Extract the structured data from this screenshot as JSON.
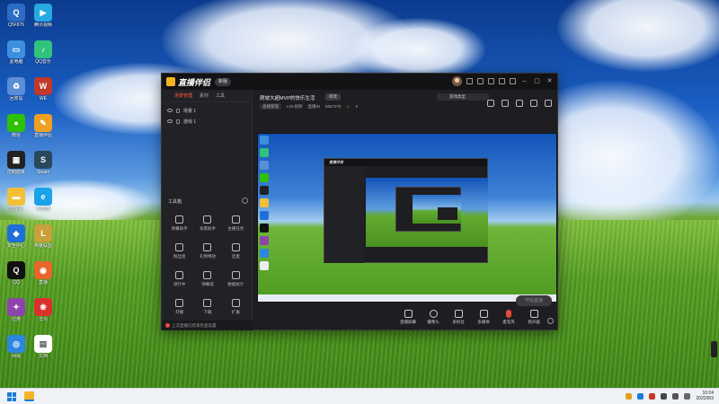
{
  "desktop": {
    "icons": [
      {
        "label": "Q5F876",
        "color": "#2d6cc4",
        "glyph": "Q"
      },
      {
        "label": "腾讯视频",
        "color": "#27a9e1",
        "glyph": "▶"
      },
      {
        "label": "此电脑",
        "color": "#3d8fe0",
        "glyph": "▭"
      },
      {
        "label": "QQ音乐",
        "color": "#31c27c",
        "glyph": "♪"
      },
      {
        "label": "回收站",
        "color": "#5a8ed6",
        "glyph": "♻"
      },
      {
        "label": "WE",
        "color": "#c0392b",
        "glyph": "W"
      },
      {
        "label": "微信",
        "color": "#2dc100",
        "glyph": "●"
      },
      {
        "label": "直播伴侣",
        "color": "#f0a020",
        "glyph": "✎"
      },
      {
        "label": "控制面板",
        "color": "#222",
        "glyph": "▦"
      },
      {
        "label": "Steam",
        "color": "#2a475e",
        "glyph": "S"
      },
      {
        "label": "文件夹",
        "color": "#f2c037",
        "glyph": "▬"
      },
      {
        "label": "浏览器",
        "color": "#1aa3e8",
        "glyph": "e"
      },
      {
        "label": "安全中心",
        "color": "#1e6fd9",
        "glyph": "◆"
      },
      {
        "label": "英雄联盟",
        "color": "#c8a03c",
        "glyph": "L"
      },
      {
        "label": "QQ",
        "color": "#111",
        "glyph": "Q"
      },
      {
        "label": "直播",
        "color": "#e6662b",
        "glyph": "◉"
      },
      {
        "label": "应用",
        "color": "#8e44ad",
        "glyph": "✦"
      },
      {
        "label": "华为",
        "color": "#d9322b",
        "glyph": "❀"
      },
      {
        "label": "网易",
        "color": "#2e86de",
        "glyph": "◎"
      },
      {
        "label": "文档",
        "color": "#ffffff",
        "glyph": "▤"
      }
    ]
  },
  "app": {
    "title": "直播伴侣",
    "version": "新版",
    "sidebar": {
      "tabs": [
        "场景管理",
        "素材",
        "工具"
      ],
      "scenes": [
        "场景 1",
        "游戏 1"
      ],
      "toolbox_title": "工具箱",
      "tools": [
        "弹幕助手",
        "背景助手",
        "主播任务",
        "粉丝团",
        "礼物特效",
        "连麦",
        "进行中",
        "弹幕墙",
        "数据统计",
        "开播",
        "下载",
        "扩展"
      ],
      "footer": "上次直播已结束检查设置"
    },
    "room": {
      "title": "爬坡大超MVP的快乐生活",
      "edit_label": "修改",
      "category_label": "游戏类型",
      "meta": [
        "直播管理",
        "LOL视频",
        "直播ID",
        "5557275",
        "0"
      ]
    },
    "controls": [
      {
        "label": "直播屏幕"
      },
      {
        "label": "摄像头"
      },
      {
        "label": "多机位"
      },
      {
        "label": "多媒体"
      },
      {
        "label": "麦克风"
      },
      {
        "label": "扬声器"
      }
    ],
    "start_label": "开始直播"
  },
  "taskbar": {
    "time": "10:24",
    "date": "2022/8/3"
  }
}
